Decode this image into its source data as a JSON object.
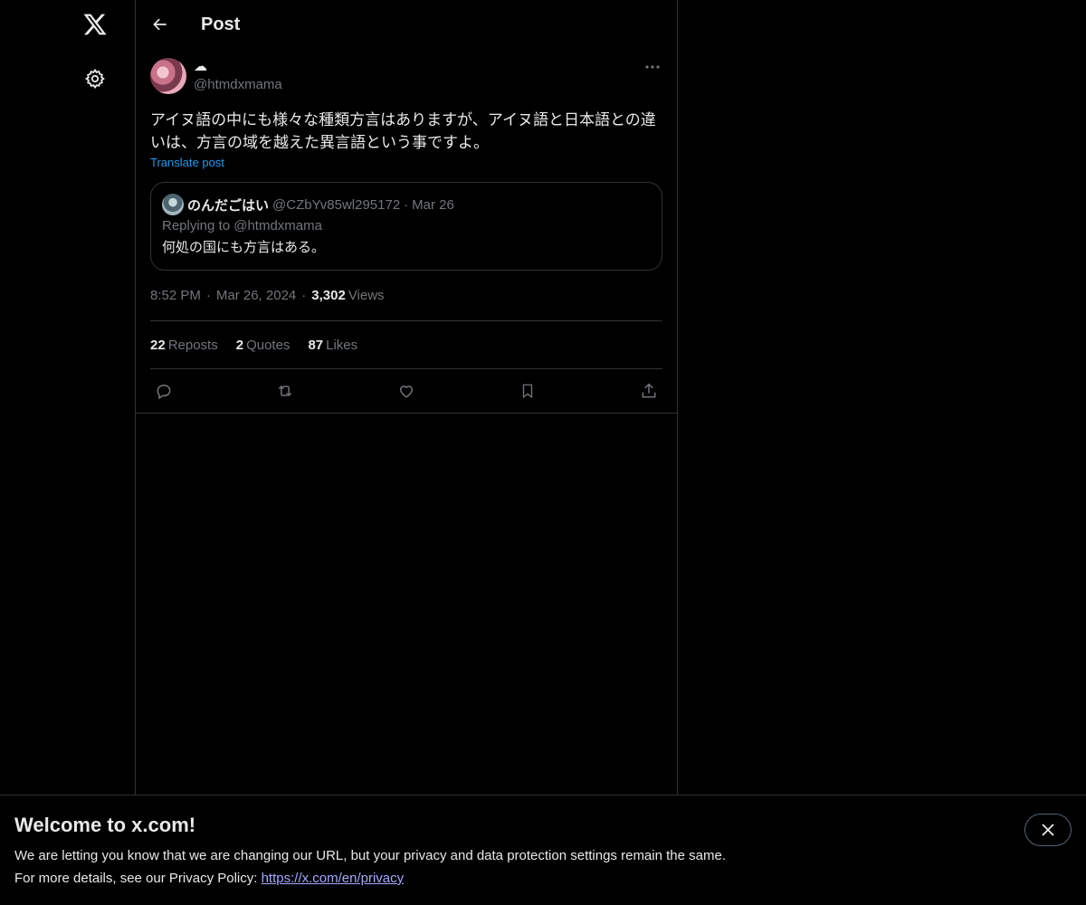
{
  "nav": {
    "logo_icon": "x-logo-icon",
    "settings_icon": "gear-icon"
  },
  "header": {
    "title": "Post"
  },
  "post": {
    "display_name": "☁",
    "handle": "@htmdxmama",
    "text_line1": "アイヌ語の中にも様々な種類方言はありますが、アイヌ語と日本語との違",
    "text_line2": "いは、方言の域を越えた異言語という事ですよ。",
    "translate_label": "Translate post",
    "quote": {
      "name": "のんだごはい",
      "handle": "@CZbYv85wl295172",
      "date": "Mar 26",
      "replying": "Replying to @htmdxmama",
      "text": "何処の国にも方言はある。"
    },
    "time": "8:52 PM",
    "date": "Mar 26, 2024",
    "views_count": "3,302",
    "views_label": "Views",
    "stats": {
      "reposts_count": "22",
      "reposts_label": "Reposts",
      "quotes_count": "2",
      "quotes_label": "Quotes",
      "likes_count": "87",
      "likes_label": "Likes"
    }
  },
  "banner": {
    "title": "Welcome to x.com!",
    "line1": "We are letting you know that we are changing our URL, but your privacy and data protection settings remain the same.",
    "line2_prefix": "For more details, see our Privacy Policy: ",
    "link": "https://x.com/en/privacy"
  },
  "colors": {
    "background": "#000000",
    "text": "#e7e9ea",
    "muted": "#71767b",
    "accent": "#1d9bf0",
    "border": "#2f3336"
  }
}
